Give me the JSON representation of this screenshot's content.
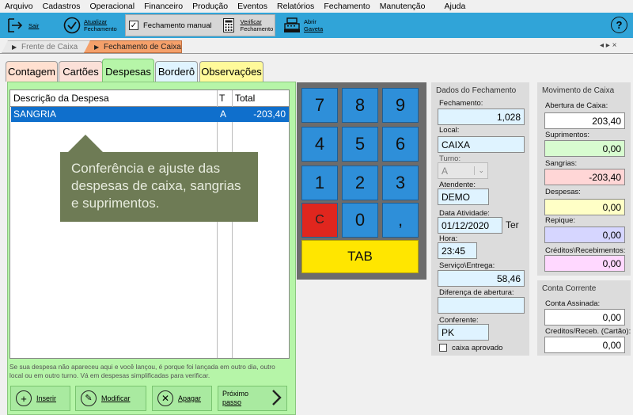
{
  "menu": [
    "Arquivo",
    "Cadastros",
    "Operacional",
    "Financeiro",
    "Produção",
    "Eventos",
    "Relatórios",
    "Fechamento",
    "Manutenção",
    "Ajuda"
  ],
  "toolbar": {
    "sair": "Sair",
    "atualizar_1": "Atualizar",
    "atualizar_2": "Fechamento",
    "manual": "Fechamento manual",
    "verificar_1": "Verificar",
    "verificar_2": "Fechamento",
    "gaveta_1": "Abrir",
    "gaveta_2": "Gaveta",
    "help": "?"
  },
  "doc_tabs": {
    "frente": "Frente de Caixa",
    "fechamento": "Fechamento de Caixa",
    "controls": "◂ ▸ ×"
  },
  "subtabs": [
    "Contagem",
    "Cartões",
    "Despesas",
    "Borderô",
    "Observações"
  ],
  "grid": {
    "headers": {
      "descricao": "Descrição da Despesa",
      "t": "T",
      "total": "Total"
    },
    "rows": [
      {
        "descricao": "SANGRIA",
        "t": "A",
        "total": "-203,40"
      }
    ]
  },
  "tooltip": "Conferência e ajuste das despesas de caixa, sangrias e suprimentos.",
  "note": "Se sua despesa não apareceu aqui e você lançou, é porque foi lançada em outro dia, outro local ou em outro turno. Vá em despesas simplificadas para verificar.",
  "actions": {
    "inserir": "Inserir",
    "modificar": "Modificar",
    "apagar": "Apagar",
    "proximo_1": "Próximo",
    "proximo_2": "passo"
  },
  "keypad": {
    "k7": "7",
    "k8": "8",
    "k9": "9",
    "k4": "4",
    "k5": "5",
    "k6": "6",
    "k1": "1",
    "k2": "2",
    "k3": "3",
    "kc": "C",
    "k0": "0",
    "kcomma": ",",
    "tab": "TAB"
  },
  "dados": {
    "title": "Dados do Fechamento",
    "fechamento_label": "Fechamento:",
    "fechamento": "1,028",
    "local_label": "Local:",
    "local": "CAIXA",
    "turno_label": "Turno:",
    "turno": "A",
    "atendente_label": "Atendente:",
    "atendente": "DEMO",
    "data_label": "Data Atividade:",
    "data": "01/12/2020",
    "dia": "Ter",
    "hora_label": "Hora:",
    "hora": "23:45",
    "servico_label": "Serviço\\Entrega:",
    "servico": "58,46",
    "diferenca_label": "Diferença de abertura:",
    "diferenca": "",
    "conferente_label": "Conferente:",
    "conferente": "PK",
    "aprovado_label": "caixa aprovado"
  },
  "movimento": {
    "title": "Movimento de Caixa",
    "abertura_label": "Abertura de Caixa:",
    "abertura": "203,40",
    "suprimentos_label": "Suprimentos:",
    "suprimentos": "0,00",
    "sangrias_label": "Sangrias:",
    "sangrias": "-203,40",
    "despesas_label": "Despesas:",
    "despesas": "0,00",
    "repique_label": "Repique:",
    "repique": "0,00",
    "creditos_label": "Créditos\\Recebimentos:",
    "creditos": "0,00"
  },
  "conta": {
    "title": "Conta Corrente",
    "assinada_label": "Conta Assinada:",
    "assinada": "0,00",
    "cartao_label": "Creditos/Receb. (Cartão):",
    "cartao": "0,00"
  },
  "colors": {
    "toolbar": "#30a4d8",
    "green_panel": "#b6f5a8",
    "selected_row": "#0f6fcc",
    "tooltip": "#6e7b55",
    "key_blue": "#2e8fd9",
    "key_red": "#e0261e",
    "key_yellow": "#ffe600",
    "active_doc_tab": "#f5a06a"
  }
}
